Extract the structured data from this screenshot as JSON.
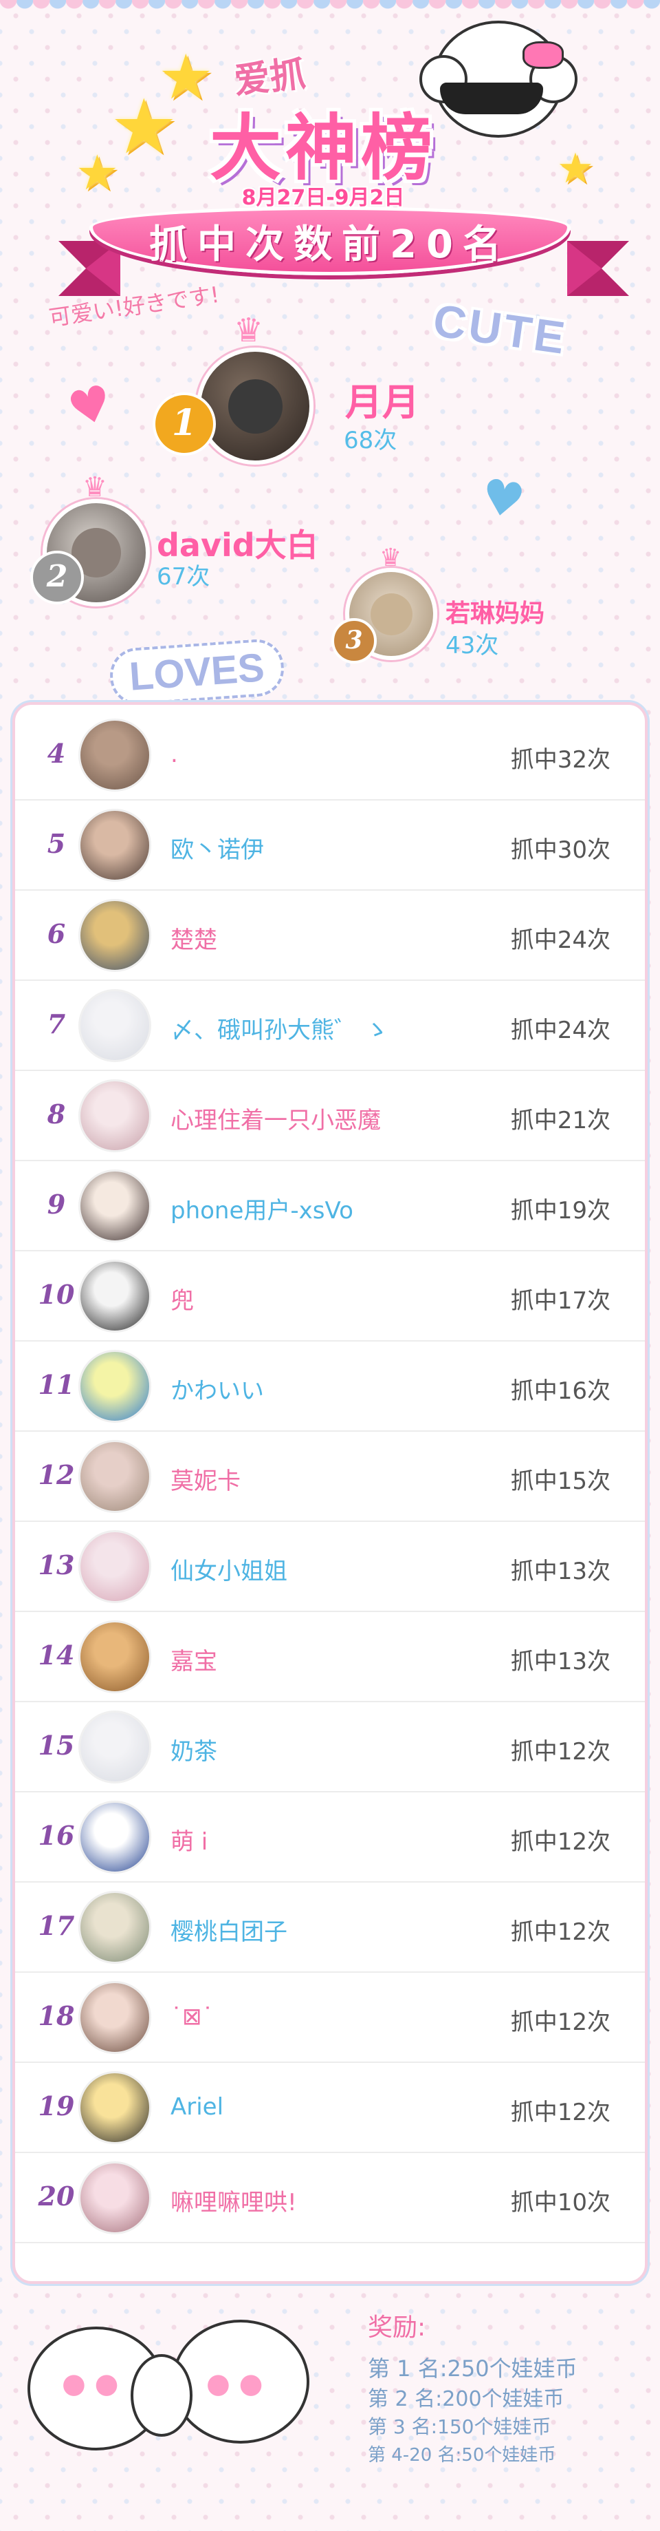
{
  "header": {
    "brand": "爱抓",
    "title": "大神榜",
    "date_range": "8月27日-9月2日",
    "ribbon": "抓中次数前20名",
    "kawaii": "可爱い!好きです!",
    "cute_sticker": "CUTE",
    "loves_sticker": "LOVES"
  },
  "podium": [
    {
      "rank": "1",
      "name": "月月",
      "count": "68次",
      "medal_color": "#f2a81f"
    },
    {
      "rank": "2",
      "name": "david大白",
      "count": "67次",
      "medal_color": "#9a9a9a"
    },
    {
      "rank": "3",
      "name": "若琳妈妈",
      "count": "43次",
      "medal_color": "#c9873f"
    }
  ],
  "list": [
    {
      "rank": "4",
      "name": ".",
      "count": "抓中32次",
      "name_color": "pink",
      "avatar": [
        "#b89a86",
        "#6c5649"
      ]
    },
    {
      "rank": "5",
      "name": "欧丶诺伊",
      "count": "抓中30次",
      "name_color": "blue",
      "avatar": [
        "#d9b9a4",
        "#4a3a34"
      ]
    },
    {
      "rank": "6",
      "name": "楚楚",
      "count": "抓中24次",
      "name_color": "pink",
      "avatar": [
        "#e1c07a",
        "#3d4f6b"
      ]
    },
    {
      "rank": "7",
      "name": "〆、硪叫孙大熊゛ ゝ",
      "count": "抓中24次",
      "name_color": "blue",
      "avatar": [
        "#f3f3f6",
        "#d8dbe2"
      ]
    },
    {
      "rank": "8",
      "name": "心理住着一只小恶魔",
      "count": "抓中21次",
      "name_color": "pink",
      "avatar": [
        "#f6e7ea",
        "#c7a0a9"
      ]
    },
    {
      "rank": "9",
      "name": "phone用户-xsVo",
      "count": "抓中19次",
      "name_color": "blue",
      "avatar": [
        "#f5e9e0",
        "#3a2c2c"
      ]
    },
    {
      "rank": "10",
      "name": "兜",
      "count": "抓中17次",
      "name_color": "pink",
      "avatar": [
        "#f4f4f4",
        "#222222"
      ]
    },
    {
      "rank": "11",
      "name": "かわいい",
      "count": "抓中16次",
      "name_color": "blue",
      "avatar": [
        "#f4f4a6",
        "#2d7bd1"
      ]
    },
    {
      "rank": "12",
      "name": "莫妮卡",
      "count": "抓中15次",
      "name_color": "pink",
      "avatar": [
        "#e6cfc8",
        "#9c8878"
      ]
    },
    {
      "rank": "13",
      "name": "仙女小姐姐",
      "count": "抓中13次",
      "name_color": "blue",
      "avatar": [
        "#f4e4ea",
        "#d8a6b6"
      ]
    },
    {
      "rank": "14",
      "name": "嘉宝",
      "count": "抓中13次",
      "name_color": "pink",
      "avatar": [
        "#e8b77a",
        "#8a5a2b"
      ]
    },
    {
      "rank": "15",
      "name": "奶茶",
      "count": "抓中12次",
      "name_color": "blue",
      "avatar": [
        "#f3f3f6",
        "#d8dbe2"
      ]
    },
    {
      "rank": "16",
      "name": "萌 i",
      "count": "抓中12次",
      "name_color": "pink",
      "avatar": [
        "#ffffff",
        "#1f3f8f"
      ]
    },
    {
      "rank": "17",
      "name": "樱桃白团子",
      "count": "抓中12次",
      "name_color": "blue",
      "avatar": [
        "#e9e2cf",
        "#7c8a74"
      ]
    },
    {
      "rank": "18",
      "name": "˙⊠˙",
      "count": "抓中12次",
      "name_color": "pink",
      "avatar": [
        "#f1d9cf",
        "#6a4b3e"
      ]
    },
    {
      "rank": "19",
      "name": "Ariel",
      "count": "抓中12次",
      "name_color": "blue",
      "avatar": [
        "#f9e29a",
        "#2a2a2a"
      ]
    },
    {
      "rank": "20",
      "name": "嘛哩嘛哩哄!",
      "count": "抓中10次",
      "name_color": "pink",
      "avatar": [
        "#f7dde4",
        "#a7737e"
      ]
    }
  ],
  "rewards": {
    "title": "奖励:",
    "items": [
      "第 1 名:250个娃娃币",
      "第 2 名:200个娃娃币",
      "第 3 名:150个娃娃币",
      "第 4-20 名:50个娃娃币"
    ]
  },
  "colors": {
    "accent_pink": "#f06fa6",
    "accent_blue": "#4eb4e3",
    "rank_purple": "#8a4fa8"
  }
}
